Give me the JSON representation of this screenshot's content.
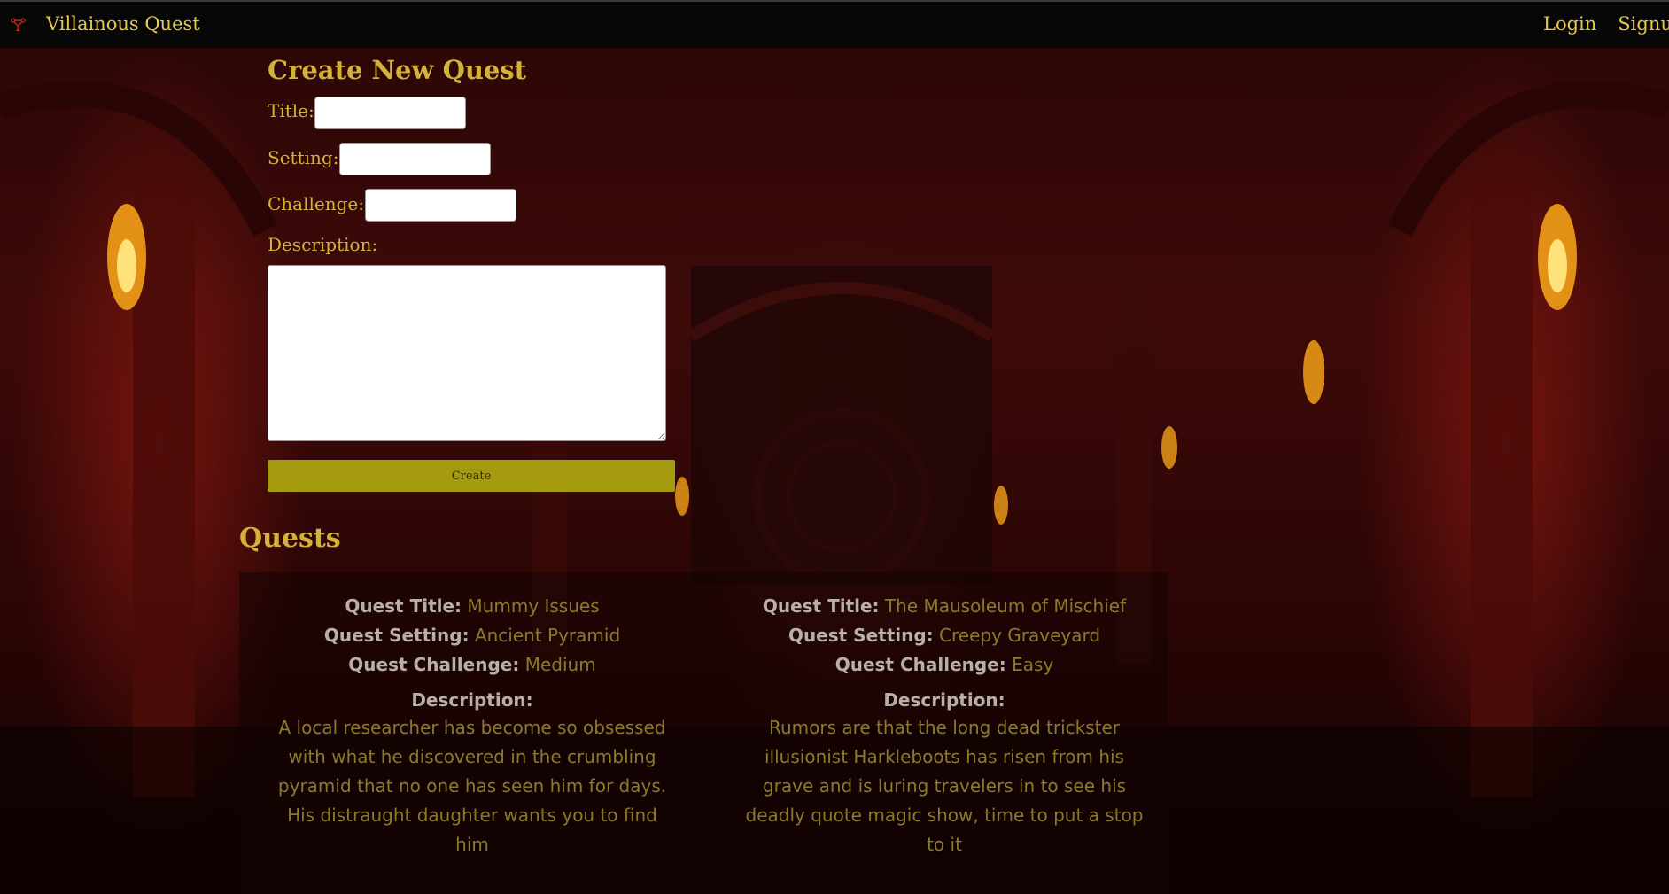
{
  "navbar": {
    "brand_icon": "🝖",
    "brand": "Villainous Quest",
    "links": {
      "login": "Login",
      "signup": "Signup"
    }
  },
  "form": {
    "title": "Create New Quest",
    "title_label": "Title:",
    "setting_label": "Setting:",
    "challenge_label": "Challenge:",
    "description_label": "Description:",
    "title_value": "",
    "setting_value": "",
    "challenge_value": "",
    "description_value": "",
    "create_label": "Create"
  },
  "quests": {
    "heading": "Quests",
    "labels": {
      "title": "Quest Title:",
      "setting": "Quest Setting:",
      "challenge": "Quest Challenge:",
      "description": "Description:"
    },
    "items": [
      {
        "title": "Mummy Issues",
        "setting": "Ancient Pyramid",
        "challenge": "Medium",
        "description": "A local researcher has become so obsessed with what he discovered in the crumbling pyramid that no one has seen him for days. His distraught daughter wants you to find him"
      },
      {
        "title": "The Mausoleum of Mischief",
        "setting": "Creepy Graveyard",
        "challenge": "Easy",
        "description": "Rumors are that the long dead trickster illusionist Harkleboots has risen from his grave and is luring travelers in to see his deadly quote magic show, time to put a stop to it"
      }
    ]
  },
  "colors": {
    "accent": "#d4b23a",
    "button": "#a49b0e",
    "value_text": "#8c7a2a",
    "key_text": "#b8b0a8"
  }
}
